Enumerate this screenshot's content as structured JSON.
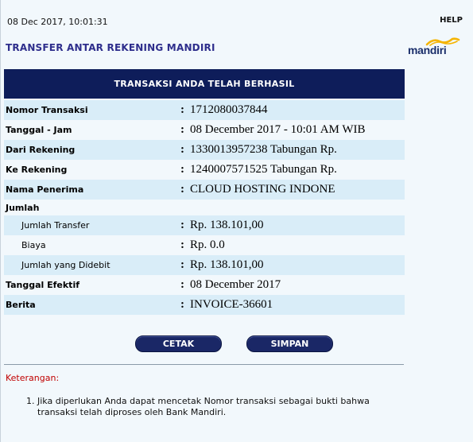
{
  "header": {
    "datetime": "08 Dec 2017, 10:01:31",
    "help_label": "HELP",
    "title": "TRANSFER ANTAR REKENING MANDIRI",
    "logo_text": "mandiri"
  },
  "banner": {
    "text": "TRANSAKSI ANDA TELAH BERHASIL"
  },
  "rows": [
    {
      "label": "Nomor Transaksi",
      "value": "1712080037844"
    },
    {
      "label": "Tanggal - Jam",
      "value": "08 December 2017 - 10:01 AM WIB"
    },
    {
      "label": "Dari Rekening",
      "value": "1330013957238 Tabungan  Rp."
    },
    {
      "label": "Ke Rekening",
      "value": "1240007571525 Tabungan Rp."
    },
    {
      "label": "Nama Penerima",
      "value": "CLOUD HOSTING INDONE"
    },
    {
      "label": "Jumlah"
    },
    {
      "label": "Jumlah Transfer",
      "value": "Rp. 138.101,00"
    },
    {
      "label": "Biaya",
      "value": "Rp. 0.0"
    },
    {
      "label": "Jumlah yang Didebit",
      "value": "Rp. 138.101,00"
    },
    {
      "label": "Tanggal Efektif",
      "value": "08 December 2017"
    },
    {
      "label": "Berita",
      "value": "INVOICE-36601"
    }
  ],
  "colon": ":",
  "buttons": {
    "cetak": "CETAK",
    "simpan": "SIMPAN"
  },
  "notes": {
    "title": "Keterangan:",
    "items": [
      {
        "num": "1.",
        "text": "Jika diperlukan Anda dapat mencetak Nomor transaksi sebagai bukti bahwa transaksi telah diproses oleh Bank Mandiri."
      }
    ]
  },
  "colors": {
    "banner": "#0e1d5a",
    "row_alt": "#d9edf8",
    "title": "#2e2e8c",
    "note_title": "#c00000",
    "logo_wave": "#f5b400"
  }
}
